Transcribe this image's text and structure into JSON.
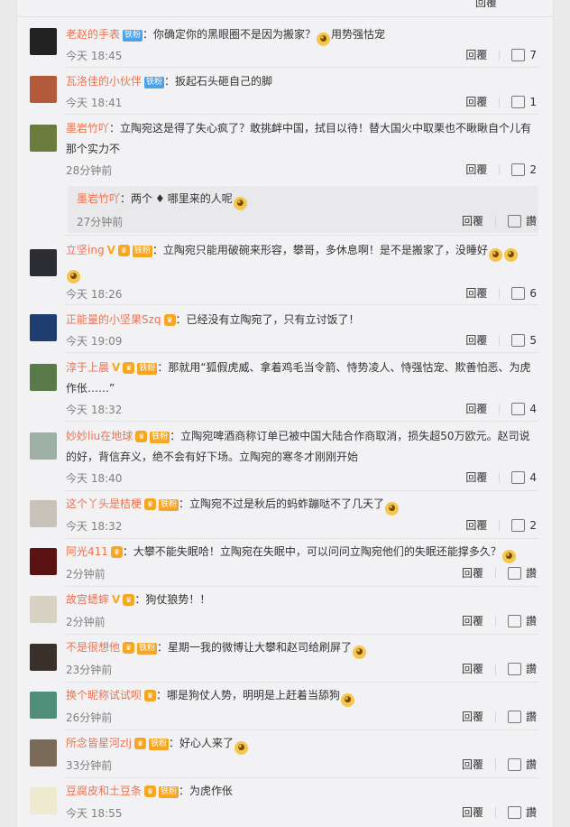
{
  "labels": {
    "reply": "回覆",
    "like_word": "讚"
  },
  "top_partial": {
    "actions_visible": true
  },
  "comments": [
    {
      "id": "c1",
      "name": "老赵的手表",
      "tag": "铁粉",
      "text": "：你确定你的黑眼圈不是因为搬家？",
      "tail": "用势强怙宠",
      "time": "今天 18:45",
      "likes": "7"
    },
    {
      "id": "c2",
      "name": "瓦洛佳的小伙伴",
      "tag": "铁粉",
      "text": "：扳起石头砸自己的脚",
      "time": "今天 18:41",
      "likes": "1"
    },
    {
      "id": "c3",
      "name": "墨岩竹吖",
      "text": "：立陶宛这是得了失心疯了？敢挑衅中国，拭目以待！替大国火中取栗也不瞅瞅自个儿有那个实力不",
      "time": "28分钟前",
      "likes": "2",
      "sub": {
        "name": "墨岩竹吖",
        "text": "：两个",
        "text2": "哪里来的人呢",
        "time": "27分钟前",
        "likes": "讚"
      }
    },
    {
      "id": "c4",
      "name": "立坚ing",
      "tag": "铁粉",
      "text": "：立陶宛只能用破碗来形容，攀哥，多休息啊！是不是搬家了，没睡好",
      "time": "今天 18:26",
      "likes": "6"
    },
    {
      "id": "c5",
      "name": "正能量的小坚果Szq",
      "text": "：已经没有立陶宛了，只有立讨饭了！",
      "time": "今天 19:09",
      "likes": "5"
    },
    {
      "id": "c6",
      "name": "淳于上晨",
      "tag": "铁粉",
      "text": "：那就用“狐假虎威、拿着鸡毛当令箭、恃势凌人、恃强怙宠、欺善怕恶、为虎作伥……”",
      "time": "今天 18:32",
      "likes": "4"
    },
    {
      "id": "c7",
      "name": "妙妙liu在地球",
      "tag": "铁粉",
      "text": "：立陶宛啤酒商称订单已被中国大陆合作商取消，损失超50万欧元。赵司说的好，背信弃义，绝不会有好下场。立陶宛的寒冬才刚刚开始",
      "time": "今天 18:40",
      "likes": "4"
    },
    {
      "id": "c8",
      "name": "这个丫头是桔梗",
      "tag": "铁粉",
      "text": "：立陶宛不过是秋后的蚂蚱蹦哒不了几天了",
      "time": "今天 18:32",
      "likes": "2"
    },
    {
      "id": "c9",
      "name": "阿光411",
      "text": "：大攀不能失眠哈！立陶宛在失眠中，可以问问立陶宛他们的失眠还能撑多久？",
      "time": "2分钟前",
      "likes": "讚"
    },
    {
      "id": "c10",
      "name": "故宫蟋蟀",
      "text": "：狗仗狼势！！",
      "time": "2分钟前",
      "likes": "讚"
    },
    {
      "id": "c11",
      "name": "不是很想他",
      "tag": "铁粉",
      "text": "：星期一我的微博让大攀和赵司给刷屏了",
      "time": "23分钟前",
      "likes": "讚"
    },
    {
      "id": "c12",
      "name": "换个昵称试试呗",
      "text": "：哪是狗仗人势，明明是上赶着当舔狗",
      "time": "26分钟前",
      "likes": "讚"
    },
    {
      "id": "c13",
      "name": "所念皆星河zlj",
      "tag": "铁粉",
      "text": "：好心人来了",
      "time": "33分钟前",
      "likes": "讚"
    },
    {
      "id": "c14",
      "name": "豆腐皮和土豆条",
      "tag": "铁粉",
      "text": "：为虎作伥",
      "time": "今天 18:55",
      "likes": "讚"
    }
  ],
  "colors": {
    "name": "#eb7350",
    "tag": "#4aa2e8",
    "fan": "#f5a623",
    "meta": "#808080"
  }
}
